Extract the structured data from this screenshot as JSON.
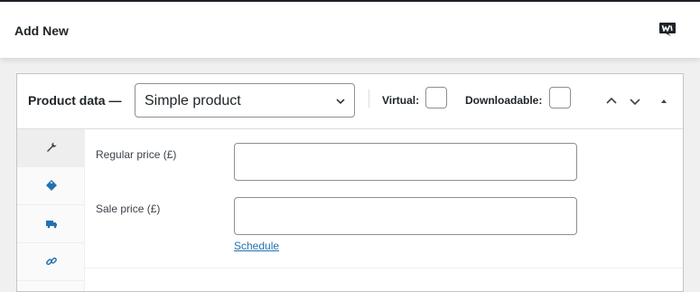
{
  "header": {
    "title": "Add New",
    "logo_icon": "woocommerce-logo-icon"
  },
  "product_data": {
    "label": "Product data —",
    "type_select": {
      "value": "Simple product",
      "icon": "chevron-down-icon"
    },
    "virtual_label": "Virtual:",
    "virtual_checked": false,
    "downloadable_label": "Downloadable:",
    "downloadable_checked": false,
    "controls": [
      "move-up-icon",
      "move-down-icon",
      "toggle-panel-icon"
    ]
  },
  "tabs": [
    {
      "name": "general",
      "icon": "wrench-icon",
      "active": true
    },
    {
      "name": "inventory",
      "icon": "tag-icon",
      "active": false
    },
    {
      "name": "shipping",
      "icon": "truck-icon",
      "active": false
    },
    {
      "name": "linked-products",
      "icon": "link-icon",
      "active": false
    }
  ],
  "general": {
    "regular_price_label": "Regular price (£)",
    "regular_price_value": "",
    "sale_price_label": "Sale price (£)",
    "sale_price_value": "",
    "schedule_link": "Schedule"
  },
  "colors": {
    "accent": "#2271b1",
    "header_bg": "#ffffff",
    "page_bg": "#f0f0f1",
    "border": "#c3c4c7"
  }
}
